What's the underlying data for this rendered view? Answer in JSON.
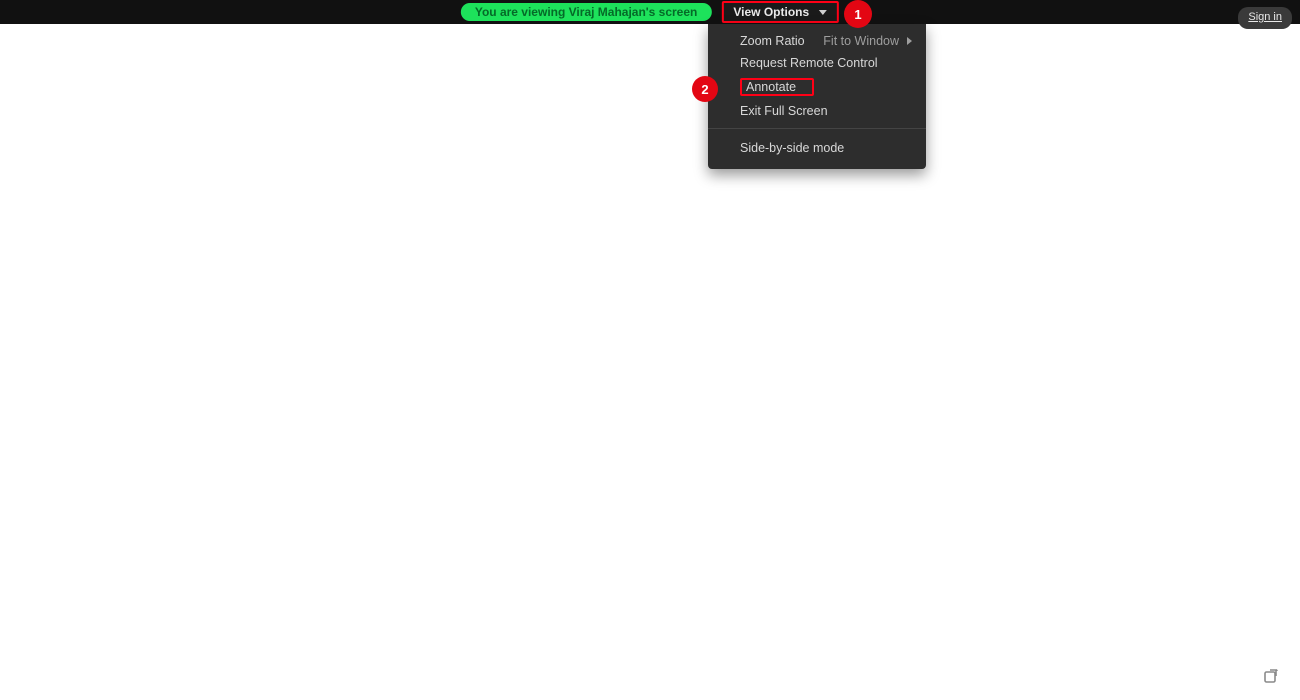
{
  "topbar": {
    "viewing_banner": "You are viewing Viraj Mahajan's screen",
    "view_options_label": "View Options",
    "sign_in_label": "Sign in"
  },
  "dropdown": {
    "zoom_ratio_label": "Zoom Ratio",
    "zoom_ratio_value": "Fit to Window",
    "request_remote_label": "Request Remote Control",
    "annotate_label": "Annotate",
    "exit_fullscreen_label": "Exit Full Screen",
    "side_by_side_label": "Side-by-side mode"
  },
  "annotations": {
    "badge1": "1",
    "badge2": "2"
  }
}
